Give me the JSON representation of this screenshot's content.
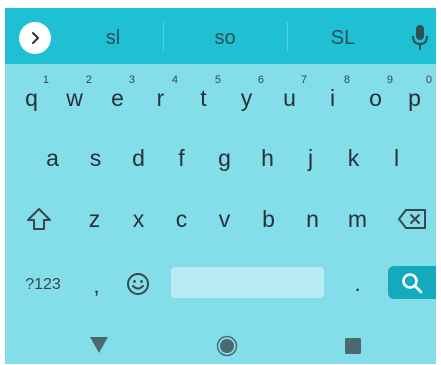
{
  "suggestions": [
    "sl",
    "so",
    "SL"
  ],
  "rows": [
    {
      "keys": [
        {
          "label": "q",
          "hint": "1"
        },
        {
          "label": "w",
          "hint": "2"
        },
        {
          "label": "e",
          "hint": "3"
        },
        {
          "label": "r",
          "hint": "4"
        },
        {
          "label": "t",
          "hint": "5"
        },
        {
          "label": "y",
          "hint": "6"
        },
        {
          "label": "u",
          "hint": "7"
        },
        {
          "label": "i",
          "hint": "8"
        },
        {
          "label": "o",
          "hint": "9"
        },
        {
          "label": "p",
          "hint": "0"
        }
      ]
    },
    {
      "keys": [
        {
          "label": "a"
        },
        {
          "label": "s"
        },
        {
          "label": "d"
        },
        {
          "label": "f"
        },
        {
          "label": "g"
        },
        {
          "label": "h"
        },
        {
          "label": "j"
        },
        {
          "label": "k"
        },
        {
          "label": "l"
        }
      ]
    },
    {
      "keys": [
        {
          "label": "z"
        },
        {
          "label": "x"
        },
        {
          "label": "c"
        },
        {
          "label": "v"
        },
        {
          "label": "b"
        },
        {
          "label": "n"
        },
        {
          "label": "m"
        }
      ]
    }
  ],
  "bottom_row": {
    "symbols_label": "?123",
    "comma_label": ",",
    "period_label": "."
  },
  "icons": {
    "expand": "chevron-right-icon",
    "mic": "microphone-icon",
    "shift": "shift-arrow-icon",
    "delete": "backspace-icon",
    "emoji": "smiley-icon",
    "search": "search-icon",
    "nav_back": "triangle-back-icon",
    "nav_home": "circle-home-icon",
    "nav_recents": "square-recents-icon"
  },
  "colors": {
    "suggestion_bar": "#20c0d4",
    "keyboard_bg": "#84deea",
    "space_key": "#b8ecf3",
    "action_key": "#14aabe",
    "key_text": "#263238"
  }
}
